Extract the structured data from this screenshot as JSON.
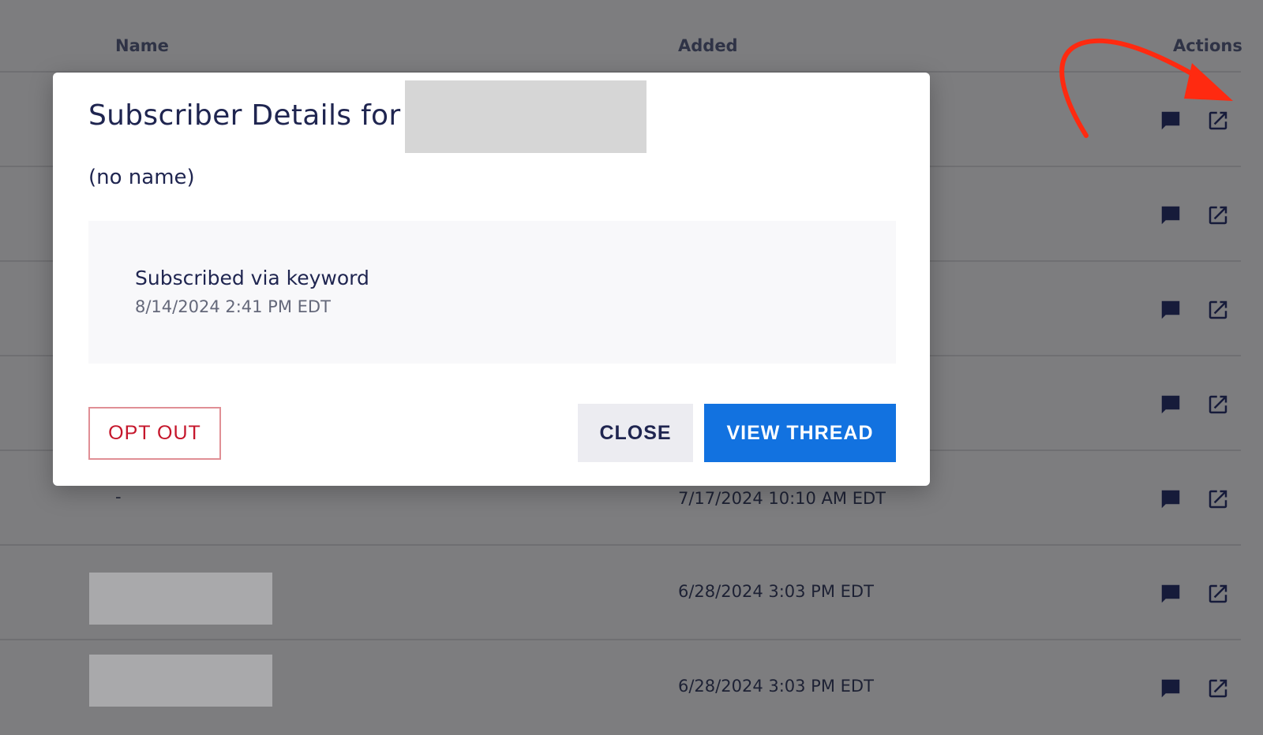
{
  "table": {
    "headers": {
      "name": "Name",
      "added": "Added",
      "actions": "Actions"
    },
    "rows": [
      {
        "name": "",
        "added": ""
      },
      {
        "name": "",
        "added": ""
      },
      {
        "name": "",
        "added": ""
      },
      {
        "name": "",
        "added": ""
      },
      {
        "name": "-",
        "added": "7/17/2024 10:10 AM EDT"
      },
      {
        "name": "",
        "added": "6/28/2024 3:03 PM EDT"
      },
      {
        "name": "",
        "added": "6/28/2024 3:03 PM EDT"
      }
    ]
  },
  "icons": {
    "message": "message-icon",
    "open": "open-in-new-icon"
  },
  "colors": {
    "primary": "#1272e0",
    "danger": "#c5162b",
    "annotation": "#ff2a10"
  },
  "modal": {
    "title": "Subscriber Details for",
    "subtitle": "(no name)",
    "event": {
      "label": "Subscribed via keyword",
      "time": "8/14/2024 2:41 PM EDT"
    },
    "buttons": {
      "opt_out": "OPT OUT",
      "close": "CLOSE",
      "view_thread": "VIEW THREAD"
    }
  }
}
